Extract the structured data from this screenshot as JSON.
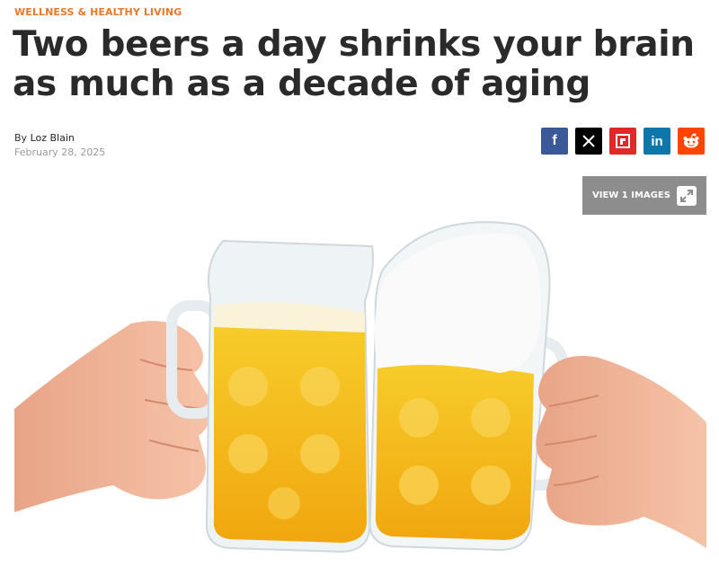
{
  "category": "WELLNESS & HEALTHY LIVING",
  "headline": "Two beers a day shrinks your brain as much as a decade of aging",
  "byline": {
    "prefix": "By ",
    "author": "Loz Blain"
  },
  "date": "February 28, 2025",
  "share": [
    {
      "icon": "facebook-icon",
      "glyph": "f",
      "color": "#3b5998"
    },
    {
      "icon": "x-icon",
      "glyph": "𝕏",
      "color": "#000000"
    },
    {
      "icon": "flipboard-icon",
      "glyph": "",
      "color": "#e12828"
    },
    {
      "icon": "linkedin-icon",
      "glyph": "in",
      "color": "#0e76a8"
    },
    {
      "icon": "reddit-icon",
      "glyph": "",
      "color": "#ff4500"
    }
  ],
  "gallery": {
    "label": "VIEW 1 IMAGES"
  },
  "colors": {
    "accent": "#e8792b",
    "headline": "#2a2a2a",
    "gallery_bg": "#8d8d8d"
  }
}
